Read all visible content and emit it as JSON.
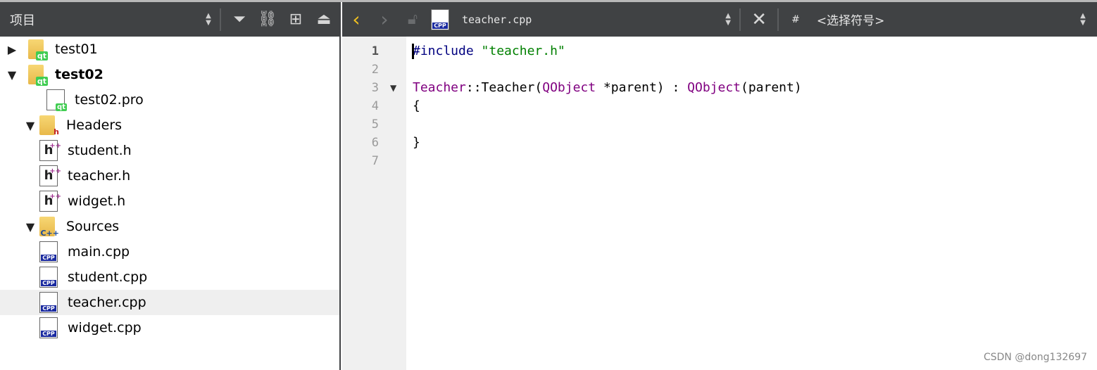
{
  "project_panel": {
    "title": "项目",
    "icons": [
      "sort-updown-icon",
      "filter-icon",
      "link-icon",
      "split-add-icon",
      "maximize-icon"
    ]
  },
  "editor_toolbar": {
    "file_name": "teacher.cpp",
    "symbol_hash": "#",
    "symbol_selector": "<选择符号>"
  },
  "tree": [
    {
      "label": "test01",
      "kind": "project",
      "expanded": false,
      "bold": false
    },
    {
      "label": "test02",
      "kind": "project",
      "expanded": true,
      "bold": true
    },
    {
      "label": "test02.pro",
      "kind": "pro"
    },
    {
      "label": "Headers",
      "kind": "folder-h",
      "expanded": true
    },
    {
      "label": "student.h",
      "kind": "h"
    },
    {
      "label": "teacher.h",
      "kind": "h"
    },
    {
      "label": "widget.h",
      "kind": "h"
    },
    {
      "label": "Sources",
      "kind": "folder-cpp",
      "expanded": true
    },
    {
      "label": "main.cpp",
      "kind": "cpp"
    },
    {
      "label": "student.cpp",
      "kind": "cpp"
    },
    {
      "label": "teacher.cpp",
      "kind": "cpp",
      "selected": true
    },
    {
      "label": "widget.cpp",
      "kind": "cpp"
    }
  ],
  "line_numbers": [
    "1",
    "2",
    "3",
    "4",
    "5",
    "6",
    "7"
  ],
  "code": [
    [
      {
        "t": "#include ",
        "c": "pre"
      },
      {
        "t": "\"teacher.h\"",
        "c": "str"
      }
    ],
    [],
    [
      {
        "t": "Teacher",
        "c": "typ"
      },
      {
        "t": "::Teacher(",
        "c": "txt"
      },
      {
        "t": "QObject",
        "c": "typ"
      },
      {
        "t": " *parent) : ",
        "c": "txt"
      },
      {
        "t": "QObject",
        "c": "typ"
      },
      {
        "t": "(parent)",
        "c": "txt"
      }
    ],
    [
      {
        "t": "{",
        "c": "txt"
      }
    ],
    [],
    [
      {
        "t": "}",
        "c": "txt"
      }
    ],
    []
  ],
  "watermark": "CSDN @dong132697"
}
